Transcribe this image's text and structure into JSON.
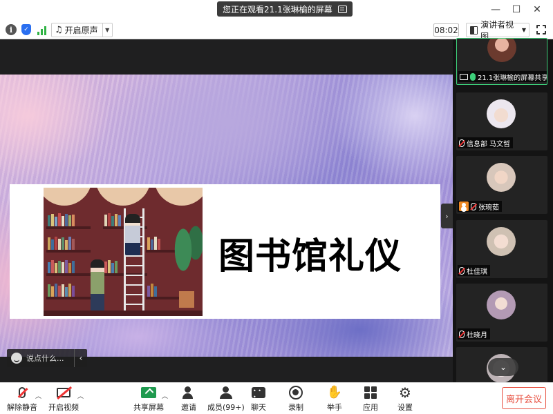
{
  "window": {
    "viewing_text": "您正在观看21.1张琳榆的屏幕"
  },
  "toolbar": {
    "original_sound_label": "开启原声",
    "timer": "08:02",
    "view_mode_label": "演讲者视图"
  },
  "slide": {
    "title": "图书馆礼仪"
  },
  "chat": {
    "placeholder": "说点什么..."
  },
  "participants": [
    {
      "name": "21.1张琳榆的屏幕共享",
      "status": "sharing"
    },
    {
      "name": "信息部  马文哲",
      "status": "muted"
    },
    {
      "name": "张琬茹",
      "status": "muted"
    },
    {
      "name": "杜佳琪",
      "status": "muted"
    },
    {
      "name": "杜晓月",
      "status": "muted"
    }
  ],
  "bottom_bar": {
    "unmute": "解除静音",
    "start_video": "开启视频",
    "share_screen": "共享屏幕",
    "invite": "邀请",
    "members": "成员(99+)",
    "chat": "聊天",
    "record": "录制",
    "raise_hand": "举手",
    "apps": "应用",
    "settings": "设置",
    "leave": "离开会议"
  },
  "colors": {
    "active_green": "#3dd07a",
    "leave_red": "#e74c3c",
    "share_green": "#1f9a4f"
  }
}
